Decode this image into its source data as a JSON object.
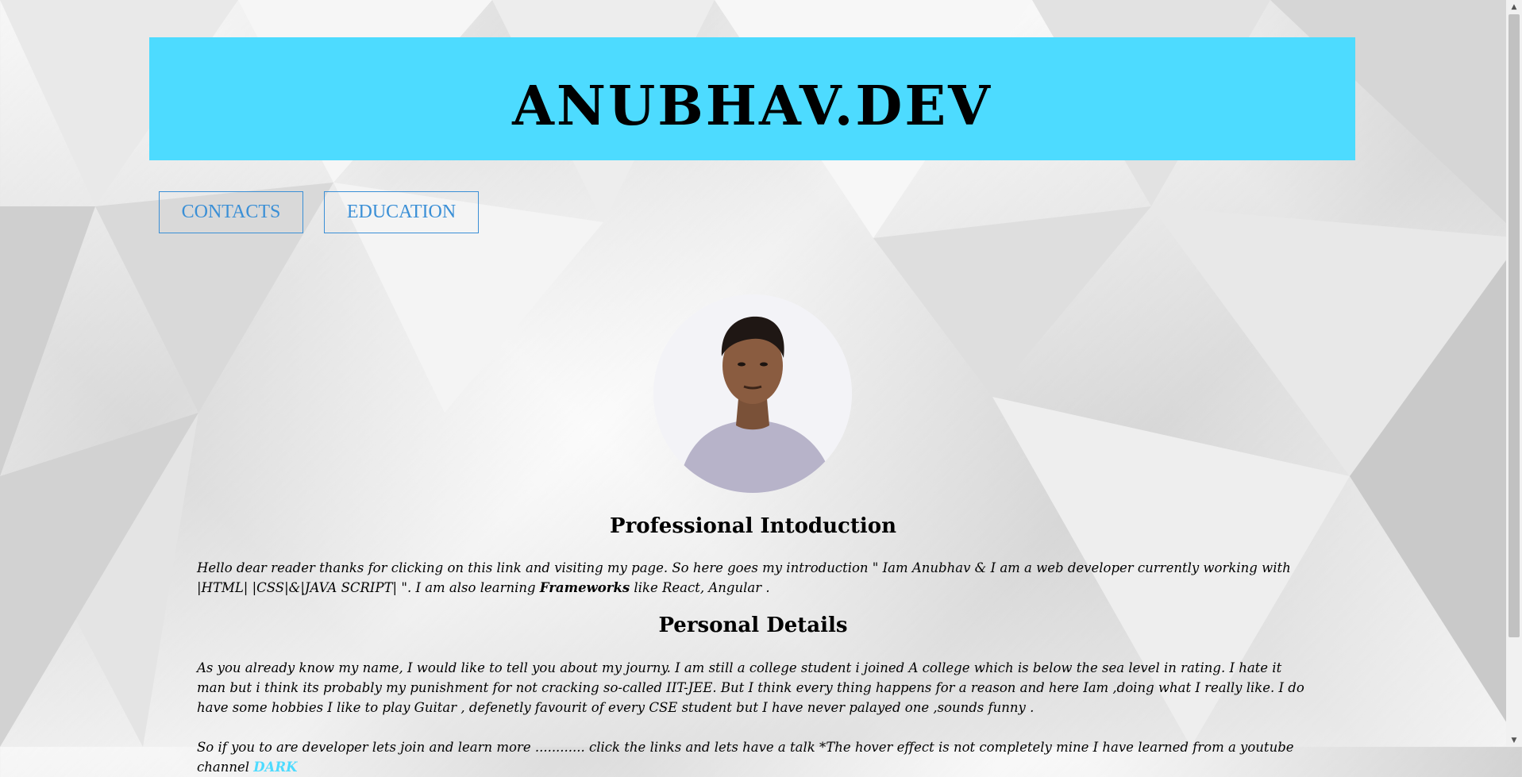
{
  "header": {
    "title": "ANUBHAV.DEV"
  },
  "nav": {
    "contacts_label": "CONTACTS",
    "education_label": "EDUCATION"
  },
  "intro": {
    "heading": "Professional Intoduction",
    "text_1": "Hello dear reader thanks for clicking on this link and visiting my page. So here goes my introduction \" Iam Anubhav & I am a web developer currently working with |HTML| |CSS|&|JAVA SCRIPT| \". I am also learning ",
    "text_bold": "Frameworks",
    "text_2": " like React, Angular ."
  },
  "personal": {
    "heading": "Personal Details",
    "text": "As you already know my name, I would like to tell you about my journy. I am still a college student i joined A college which is below the sea level in rating. I hate it man but i think its probably my punishment for not cracking so-called IIT-JEE. But I think every thing happens for a reason and here Iam ,doing what I really like. I do have some hobbies I like to play Guitar , defenetly favourit of every CSE student but I have never palayed one ,sounds funny ."
  },
  "footer_text": {
    "text": "So if you to are developer lets join and learn more ............ click the links and lets have a talk *The hover effect is not completely mine I have learned from a youtube channel ",
    "link": "DARK"
  },
  "icons": {
    "profile_photo": "avatar-photo"
  },
  "colors": {
    "banner": "#4ddbff",
    "nav_accent": "#3a8fd6",
    "link": "#4ddbff"
  }
}
